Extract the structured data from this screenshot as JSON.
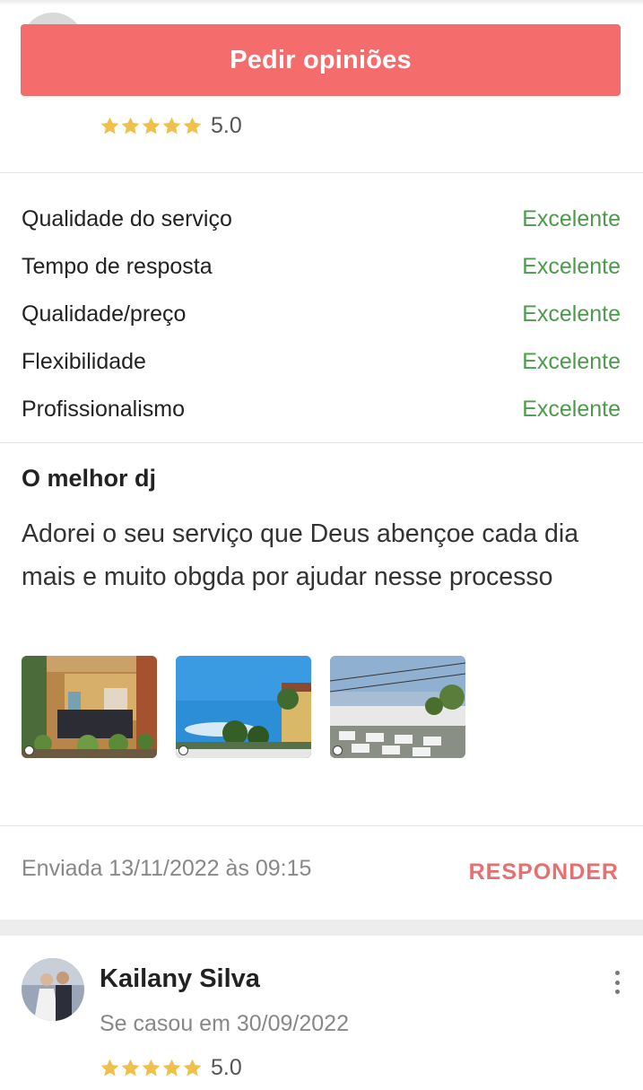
{
  "cta": {
    "label": "Pedir opiniões",
    "color": "#f56c6c"
  },
  "summary": {
    "stars": 5,
    "rating_label": "5.0"
  },
  "sub_ratings": [
    {
      "label": "Qualidade do serviço",
      "value": "Excelente"
    },
    {
      "label": "Tempo de resposta",
      "value": "Excelente"
    },
    {
      "label": "Qualidade/preço",
      "value": "Excelente"
    },
    {
      "label": "Flexibilidade",
      "value": "Excelente"
    },
    {
      "label": "Profissionalismo",
      "value": "Excelente"
    }
  ],
  "review": {
    "title": "O melhor dj",
    "body": "Adorei o seu serviço que Deus abençoe cada dia mais e muito obgda por ajudar nesse processo",
    "photos": [
      "dj-booth-photo",
      "venue-sky-photo",
      "event-tables-photo"
    ],
    "sent": "Enviada 13/11/2022 às 09:15",
    "reply_label": "RESPONDER"
  },
  "next_review": {
    "author": "Kailany Silva",
    "married": "Se casou em 30/09/2022",
    "stars": 5,
    "rating_label": "5.0"
  },
  "colors": {
    "star": "#efc14b",
    "excellent": "#4b9b4b",
    "reply": "#e86f70"
  }
}
